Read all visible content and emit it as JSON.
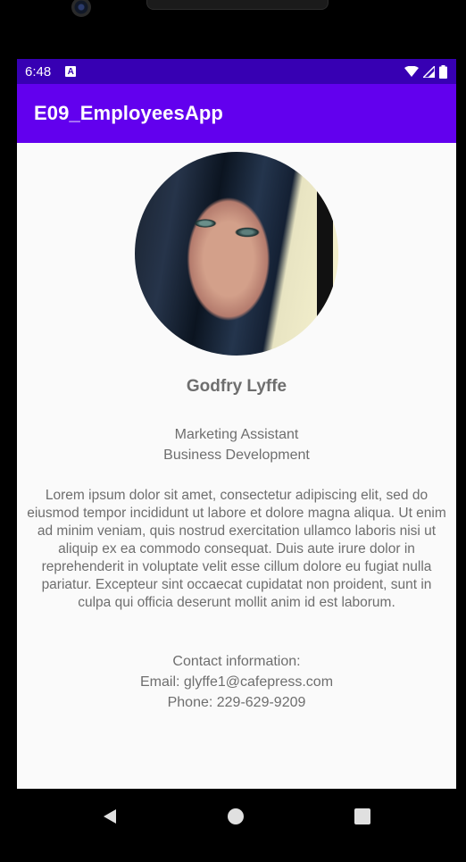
{
  "status_bar": {
    "time": "6:48",
    "notification_icon": "A"
  },
  "app_bar": {
    "title": "E09_EmployeesApp"
  },
  "employee": {
    "name": "Godfry Lyffe",
    "title_line": "Marketing Assistant",
    "department": "Business Development",
    "bio": "Lorem ipsum dolor sit amet, consectetur adipiscing elit, sed do eiusmod tempor incididunt ut labore et dolore magna aliqua. Ut enim ad minim veniam, quis nostrud exercitation ullamco laboris nisi ut aliquip ex ea commodo consequat. Duis aute irure dolor in reprehenderit in voluptate velit esse cillum dolore eu fugiat nulla pariatur. Excepteur sint occaecat cupidatat non proident, sunt in culpa qui officia deserunt mollit anim id est laborum.",
    "contact_heading": "Contact information:",
    "email_line": "Email: glyffe1@cafepress.com",
    "phone_line": "Phone: 229-629-9209"
  },
  "icons": {
    "wifi": "wifi-icon",
    "signal": "signal-icon",
    "battery": "battery-icon",
    "back": "back-icon",
    "home": "home-icon",
    "recents": "recents-icon"
  },
  "colors": {
    "status_bar": "#3700b3",
    "app_bar": "#6200ee",
    "background": "#fafafa",
    "text": "#6e6e6e"
  }
}
